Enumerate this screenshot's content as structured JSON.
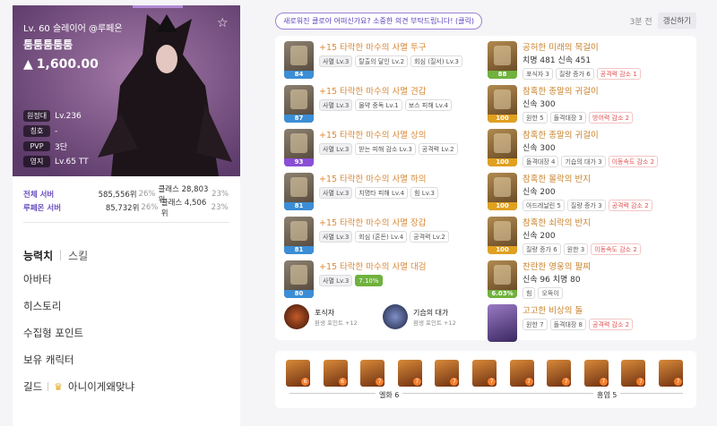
{
  "profile": {
    "level_line": "Lv. 60 슬레이어 @루페온",
    "name": "툼툼툼툼툼",
    "power": "1,600.00",
    "stats": [
      {
        "label": "원정대",
        "value": "Lv.236"
      },
      {
        "label": "칭호",
        "value": "-"
      },
      {
        "label": "PVP",
        "value": "3단"
      },
      {
        "label": "영지",
        "value": "Lv.65 TT"
      }
    ]
  },
  "ranks": [
    {
      "label": "전체 서버",
      "rank": "585,556위",
      "pct": "26%",
      "cls": "클래스 28,803위",
      "cls_pct": "23%"
    },
    {
      "label": "루페온 서버",
      "rank": "85,732위",
      "pct": "26%",
      "cls": "클래스 4,506위",
      "cls_pct": "23%"
    }
  ],
  "tabs": {
    "active": "능력치",
    "inactive": "스킬"
  },
  "menu": [
    "아바타",
    "히스토리",
    "수집형 포인트",
    "보유 캐릭터"
  ],
  "guild": {
    "label": "길드",
    "name": "아니이게왜맞냐"
  },
  "notice": "새로워진 클로아 어떠신가요? 소중한 의견 부탁드립니다! (클릭)",
  "time": "3분 전",
  "refresh": "갱신하기",
  "equipment": [
    {
      "name": "+15 타락한 마수의 사멸 투구",
      "q": "84",
      "qcolor": "#3b8ed6",
      "tags": [
        {
          "t": "사멸 Lv.3",
          "c": "gray"
        },
        {
          "t": "탈출의 달인 Lv.2",
          "c": ""
        },
        {
          "t": "회심 (질서) Lv.3",
          "c": ""
        }
      ]
    },
    {
      "name": "+15 타락한 마수의 사멸 견갑",
      "q": "87",
      "qcolor": "#3b8ed6",
      "tags": [
        {
          "t": "사멸 Lv.3",
          "c": "gray"
        },
        {
          "t": "물약 중독 Lv.1",
          "c": ""
        },
        {
          "t": "보스 피해 Lv.4",
          "c": ""
        }
      ]
    },
    {
      "name": "+15 타락한 마수의 사멸 상의",
      "q": "93",
      "qcolor": "#8a4fd6",
      "tags": [
        {
          "t": "사멸 Lv.3",
          "c": "gray"
        },
        {
          "t": "받는 피해 감소 Lv.3",
          "c": ""
        },
        {
          "t": "공격력 Lv.2",
          "c": ""
        }
      ]
    },
    {
      "name": "+15 타락한 마수의 사멸 하의",
      "q": "81",
      "qcolor": "#3b8ed6",
      "tags": [
        {
          "t": "사멸 Lv.3",
          "c": "gray"
        },
        {
          "t": "치명타 피해 Lv.4",
          "c": ""
        },
        {
          "t": "힘 Lv.3",
          "c": ""
        }
      ]
    },
    {
      "name": "+15 타락한 마수의 사멸 장갑",
      "q": "81",
      "qcolor": "#3b8ed6",
      "tags": [
        {
          "t": "사멸 Lv.3",
          "c": "gray"
        },
        {
          "t": "회심 (혼돈) Lv.4",
          "c": ""
        },
        {
          "t": "공격력 Lv.2",
          "c": ""
        }
      ]
    },
    {
      "name": "+15 타락한 마수의 사멸 대검",
      "q": "80",
      "qcolor": "#3b8ed6",
      "tags": [
        {
          "t": "사멸 Lv.3",
          "c": "gray"
        },
        {
          "t": "7.10%",
          "c": "green"
        }
      ]
    }
  ],
  "accessories": [
    {
      "name": "공허한 미래의 목걸이",
      "q": "88",
      "qcolor": "#6fb23d",
      "stat": "치명 481 신속 451",
      "tags": [
        {
          "t": "포식자 3",
          "c": ""
        },
        {
          "t": "질량 증가 6",
          "c": ""
        },
        {
          "t": "공격력 감소 1",
          "c": "red"
        }
      ]
    },
    {
      "name": "참혹한 종말의 귀걸이",
      "q": "100",
      "qcolor": "#e0a020",
      "stat": "신속 300",
      "tags": [
        {
          "t": "원한 5",
          "c": ""
        },
        {
          "t": "돌격대장 3",
          "c": ""
        },
        {
          "t": "방어력 감소 2",
          "c": "red"
        }
      ]
    },
    {
      "name": "참혹한 종말의 귀걸이",
      "q": "100",
      "qcolor": "#e0a020",
      "stat": "신속 300",
      "tags": [
        {
          "t": "돌격대장 4",
          "c": ""
        },
        {
          "t": "기습의 대가 3",
          "c": ""
        },
        {
          "t": "이동속도 감소 2",
          "c": "red"
        }
      ]
    },
    {
      "name": "참혹한 몰락의 반지",
      "q": "100",
      "qcolor": "#e0a020",
      "stat": "신속 200",
      "tags": [
        {
          "t": "아드레날린 5",
          "c": ""
        },
        {
          "t": "질량 증가 3",
          "c": ""
        },
        {
          "t": "공격력 감소 2",
          "c": "red"
        }
      ]
    },
    {
      "name": "참혹한 쇠락의 반지",
      "q": "100",
      "qcolor": "#e0a020",
      "stat": "신속 200",
      "tags": [
        {
          "t": "질량 증가 6",
          "c": ""
        },
        {
          "t": "원한 3",
          "c": ""
        },
        {
          "t": "이동속도 감소 2",
          "c": "red"
        }
      ]
    },
    {
      "name": "찬란한 영웅의 팔찌",
      "q": "6.03%",
      "qcolor": "#6fb23d",
      "stat": "신속 96 치명 80",
      "tags": [
        {
          "t": "힘",
          "c": ""
        },
        {
          "t": "오뚝이",
          "c": ""
        }
      ]
    }
  ],
  "stone": {
    "name": "고고한 비상의 돌",
    "tags": [
      {
        "t": "원한 7",
        "c": ""
      },
      {
        "t": "돌격대장 8",
        "c": ""
      },
      {
        "t": "공격력 감소 2",
        "c": "red"
      }
    ]
  },
  "engravings": [
    {
      "name": "포식자",
      "sub": "환생 포인트 +12"
    },
    {
      "name": "기습의 대가",
      "sub": "환생 포인트 +12"
    }
  ],
  "cards": [
    "6",
    "6",
    "7",
    "7",
    "7",
    "7",
    "7",
    "7",
    "7",
    "7",
    "7"
  ],
  "card_sets": [
    {
      "label": "엘화 6"
    },
    {
      "label": "흥염 5"
    }
  ]
}
